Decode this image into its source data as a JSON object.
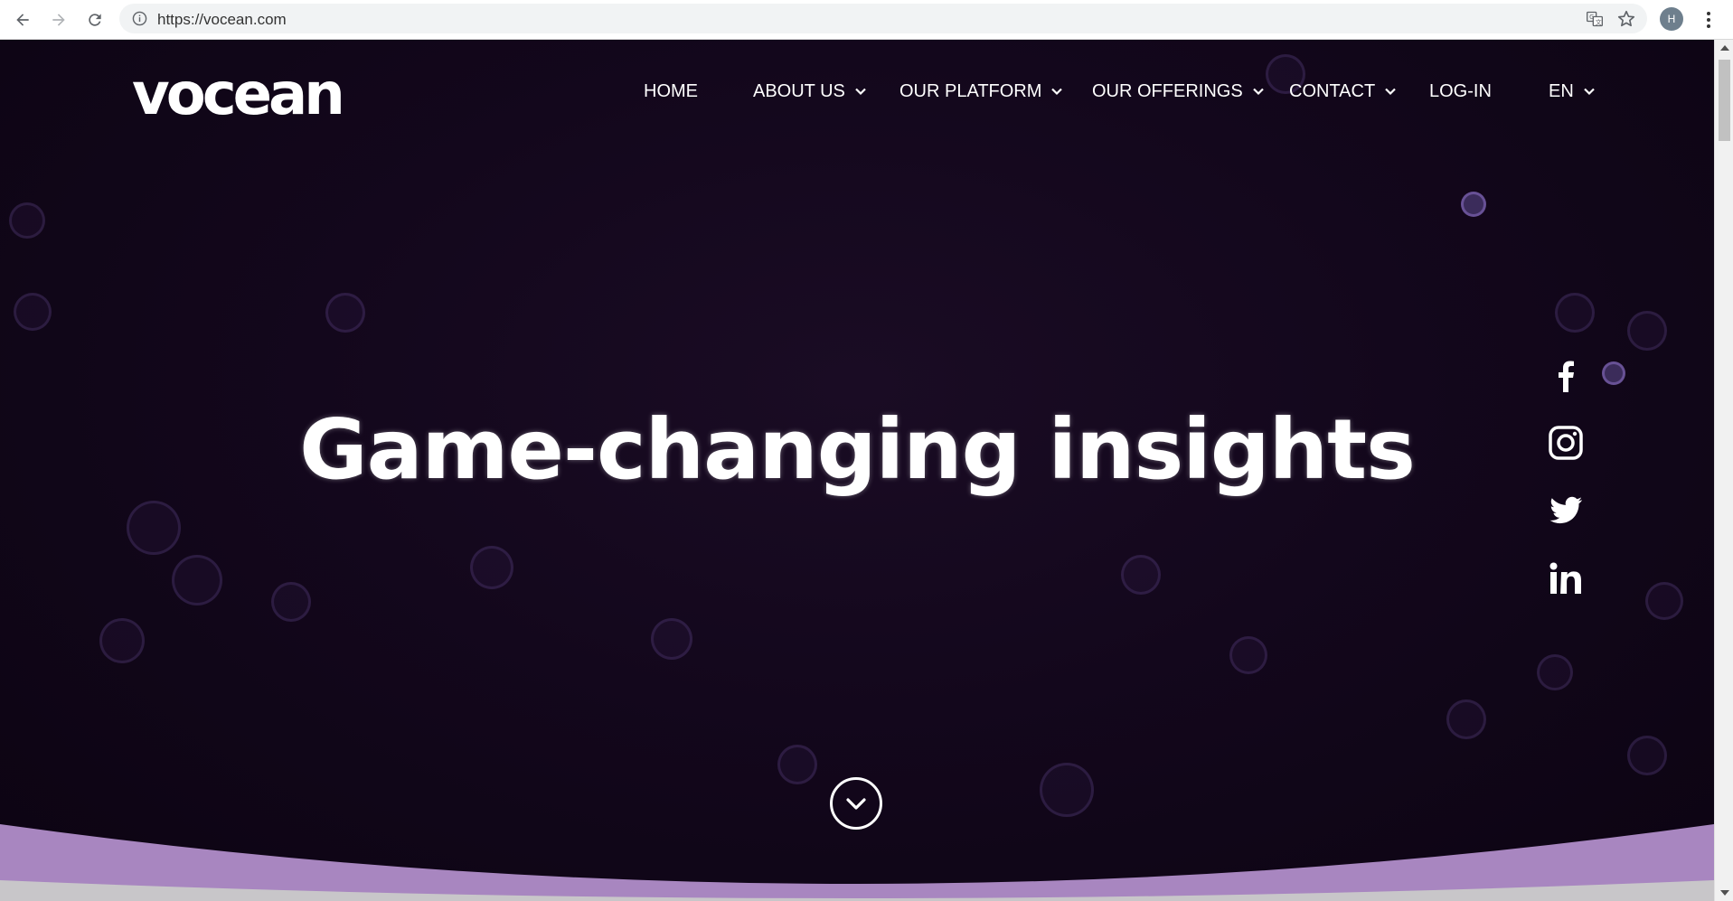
{
  "browser": {
    "url": "https://vocean.com",
    "profile_initial": "H",
    "icons": {
      "back": "arrow-left-icon",
      "forward": "arrow-right-icon",
      "reload": "reload-icon",
      "info": "info-icon",
      "translate": "translate-icon",
      "bookmark": "star-icon",
      "menu": "kebab-menu-icon"
    }
  },
  "site": {
    "logo_text": "vocean",
    "nav": {
      "items": [
        {
          "label": "HOME",
          "has_dropdown": false
        },
        {
          "label": "ABOUT US",
          "has_dropdown": true
        },
        {
          "label": "OUR PLATFORM",
          "has_dropdown": true
        },
        {
          "label": "OUR OFFERINGS",
          "has_dropdown": true
        },
        {
          "label": "CONTACT",
          "has_dropdown": true
        },
        {
          "label": "LOG-IN",
          "has_dropdown": false
        },
        {
          "label": "EN",
          "has_dropdown": true
        }
      ]
    },
    "hero": {
      "headline": "Game-changing insights"
    },
    "social": [
      {
        "name": "facebook-icon"
      },
      {
        "name": "instagram-icon"
      },
      {
        "name": "twitter-icon"
      },
      {
        "name": "linkedin-icon"
      }
    ]
  },
  "colors": {
    "background": "#13071c",
    "text": "#ffffff",
    "wave_purple": "#a886c0",
    "wave_gray": "#c8c6c9"
  }
}
